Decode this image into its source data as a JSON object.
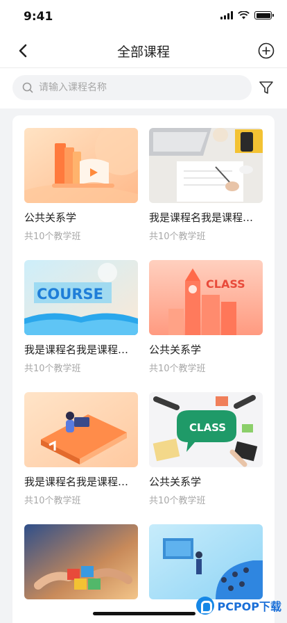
{
  "status_bar": {
    "time": "9:41"
  },
  "nav": {
    "title": "全部课程"
  },
  "search": {
    "placeholder": "请输入课程名称"
  },
  "courses": [
    {
      "name": "公共关系学",
      "count": "共10个教学班",
      "thumb": "books-orange"
    },
    {
      "name": "我是课程名我是课程名我是课程名",
      "count": "共10个教学班",
      "thumb": "desk-laptop"
    },
    {
      "name": "我是课程名我是课程名我是课程名",
      "count": "共10个教学班",
      "thumb": "course-book",
      "thumb_text": "COURSE"
    },
    {
      "name": "公共关系学",
      "count": "共10个教学班",
      "thumb": "class-city",
      "thumb_text": "CLASS"
    },
    {
      "name": "我是课程名我是课程名我是课程名",
      "count": "共10个教学班",
      "thumb": "reader-book"
    },
    {
      "name": "公共关系学",
      "count": "共10个教学班",
      "thumb": "class-bubble",
      "thumb_text": "CLASS"
    },
    {
      "name": "",
      "count": "",
      "thumb": "puzzle-hands"
    },
    {
      "name": "",
      "count": "",
      "thumb": "presentation"
    }
  ],
  "watermark": {
    "text": "PCPOP下载"
  },
  "colors": {
    "accent": "#1687e6",
    "page_bg": "#f2f3f5",
    "count_text": "#a8a8a8"
  }
}
